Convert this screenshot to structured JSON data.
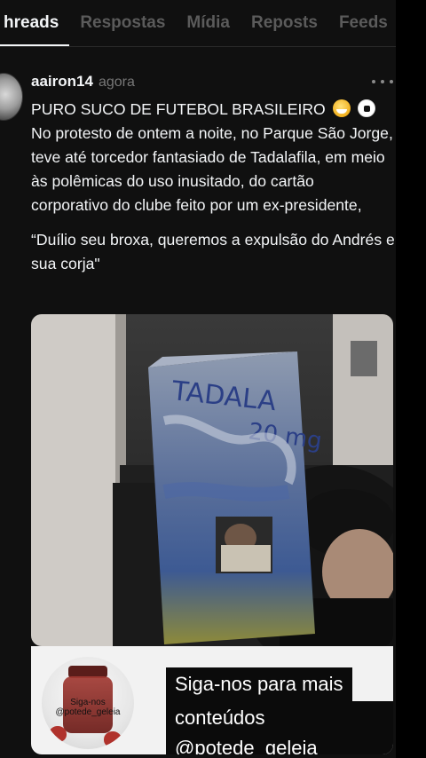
{
  "tabs": [
    {
      "label": "hreads",
      "active": true
    },
    {
      "label": "Respostas",
      "active": false
    },
    {
      "label": "Mídia",
      "active": false
    },
    {
      "label": "Reposts",
      "active": false
    },
    {
      "label": "Feeds",
      "active": false
    }
  ],
  "post": {
    "username": "aairon14",
    "time": "agora",
    "headline": "PURO SUCO DE FUTEBOL BRASILEIRO",
    "headline_emojis": [
      "grinning-sweat-emoji",
      "soccer-ball-emoji"
    ],
    "body": "No protesto de ontem a noite, no Parque São Jorge, teve até torcedor fantasiado de Tadalafila, em meio às polêmicas do uso inusitado, do cartão corporativo do clube feito por um ex-presidente,",
    "quote": "“Duílio seu broxa, queremos a expulsão do Andrés e sua corja\""
  },
  "media": {
    "box_text_line1": "TADALA",
    "box_text_line2": "20 mg",
    "jar_label": "Siga-nos @potede_geleia",
    "cta_line1": "Siga-nos para mais",
    "cta_line2": "conteúdos @potede_geleia"
  },
  "colors": {
    "background": "#101010",
    "text": "#f3f5f7",
    "muted": "#777777",
    "tab_inactive": "#5b5b5b"
  }
}
